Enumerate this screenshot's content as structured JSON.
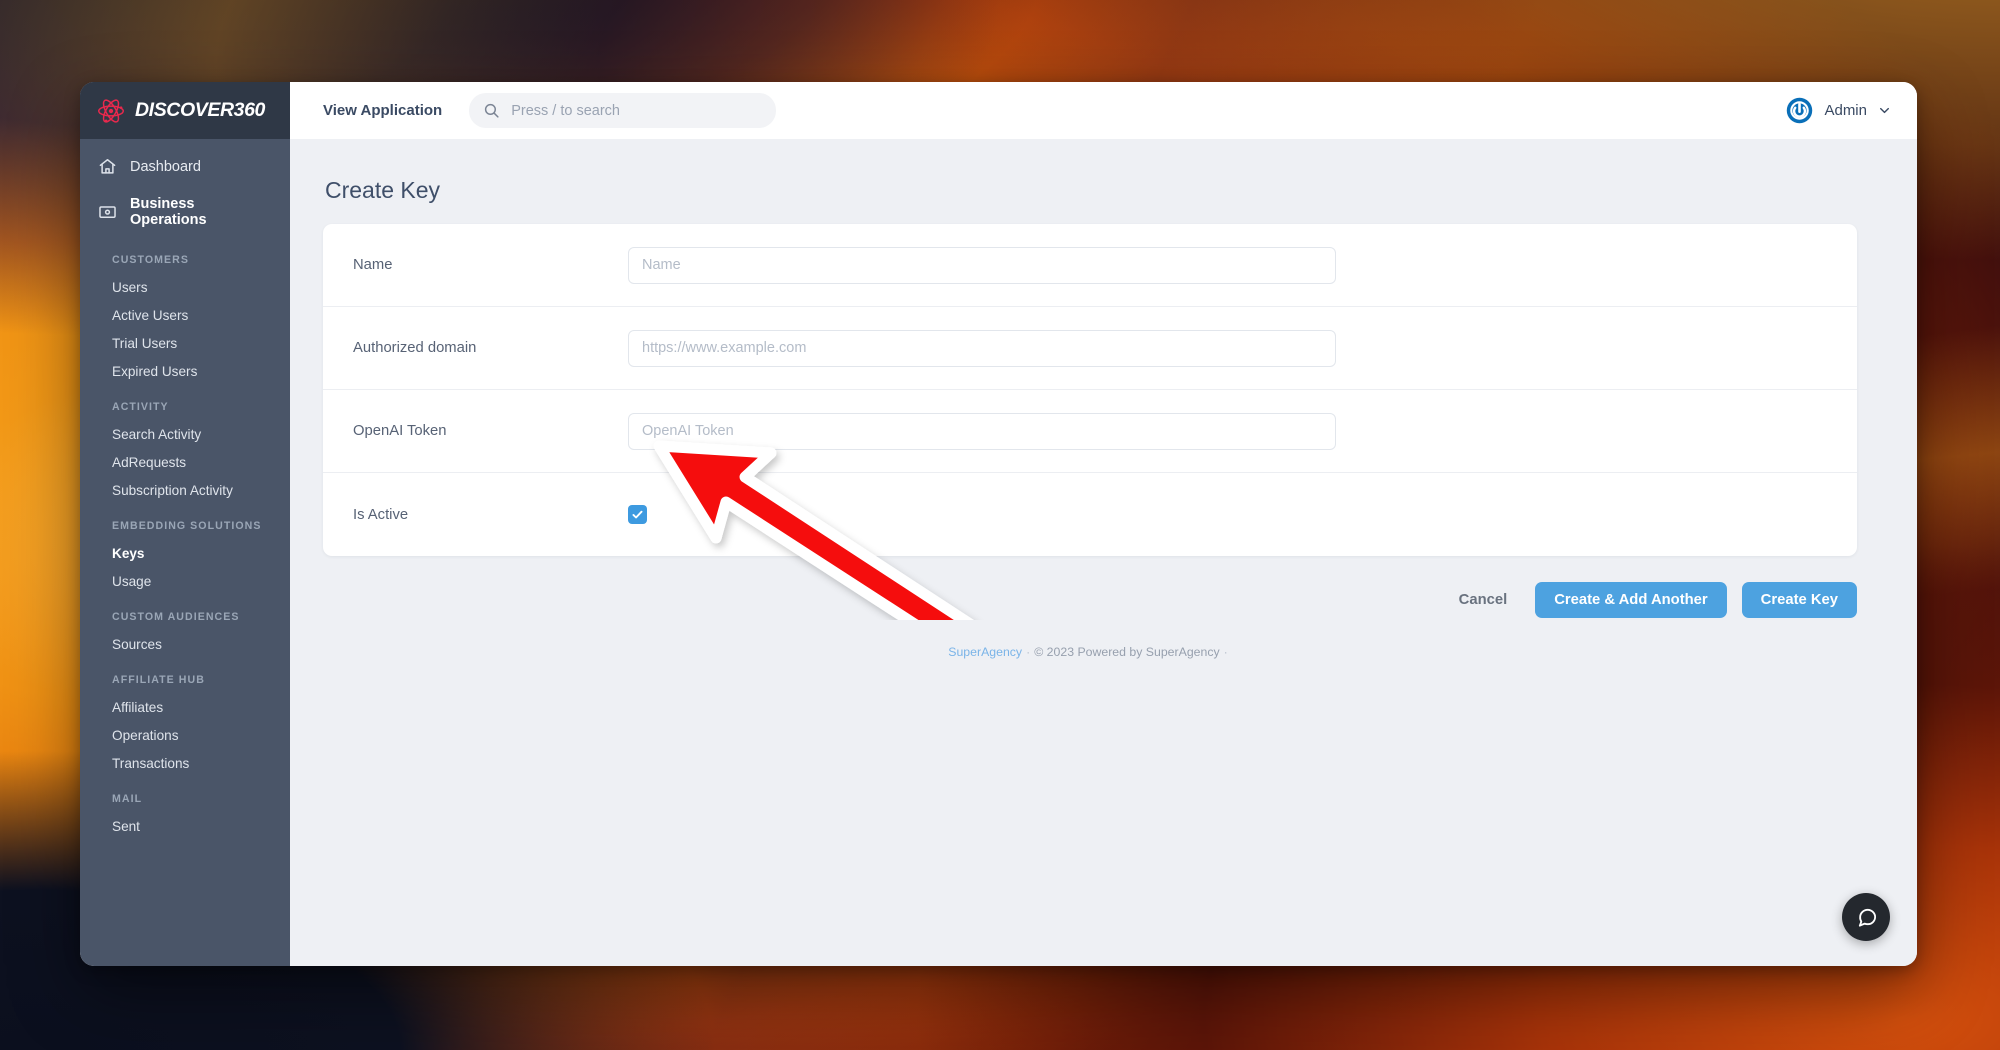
{
  "brand": {
    "name": "DISCOVER360",
    "logo_icon": "atom-icon",
    "logo_color": "#e8294d"
  },
  "sidebar": {
    "top_items": [
      {
        "label": "Dashboard",
        "icon": "home-icon",
        "bold": false
      },
      {
        "label": "Business Operations",
        "icon": "presentation-icon",
        "bold": true
      }
    ],
    "groups": [
      {
        "title": "CUSTOMERS",
        "items": [
          {
            "label": "Users",
            "active": false
          },
          {
            "label": "Active Users",
            "active": false
          },
          {
            "label": "Trial Users",
            "active": false
          },
          {
            "label": "Expired Users",
            "active": false
          }
        ]
      },
      {
        "title": "ACTIVITY",
        "items": [
          {
            "label": "Search Activity",
            "active": false
          },
          {
            "label": "AdRequests",
            "active": false
          },
          {
            "label": "Subscription Activity",
            "active": false
          }
        ]
      },
      {
        "title": "EMBEDDING SOLUTIONS",
        "items": [
          {
            "label": "Keys",
            "active": true
          },
          {
            "label": "Usage",
            "active": false
          }
        ]
      },
      {
        "title": "CUSTOM AUDIENCES",
        "items": [
          {
            "label": "Sources",
            "active": false
          }
        ]
      },
      {
        "title": "AFFILIATE HUB",
        "items": [
          {
            "label": "Affiliates",
            "active": false
          },
          {
            "label": "Operations",
            "active": false
          },
          {
            "label": "Transactions",
            "active": false
          }
        ]
      },
      {
        "title": "MAIL",
        "items": [
          {
            "label": "Sent",
            "active": false
          }
        ]
      }
    ]
  },
  "topbar": {
    "view_application_label": "View Application",
    "search": {
      "icon": "search-icon",
      "placeholder": "Press / to search",
      "value": ""
    },
    "user": {
      "label": "Admin",
      "avatar_icon": "power-circle-avatar-icon",
      "avatar_color": "#0a6fb8",
      "chevron_icon": "chevron-down-icon"
    }
  },
  "main": {
    "page_title": "Create Key",
    "form": {
      "rows": [
        {
          "label": "Name",
          "type": "text",
          "placeholder": "Name",
          "value": ""
        },
        {
          "label": "Authorized domain",
          "type": "text",
          "placeholder": "https://www.example.com",
          "value": ""
        },
        {
          "label": "OpenAI Token",
          "type": "text",
          "placeholder": "OpenAI Token",
          "value": ""
        },
        {
          "label": "Is Active",
          "type": "checkbox",
          "checked": true
        }
      ]
    },
    "actions": {
      "cancel_label": "Cancel",
      "create_add_another_label": "Create & Add Another",
      "create_key_label": "Create Key",
      "primary_color": "#4da2e0"
    },
    "footer": {
      "link_label": "SuperAgency",
      "separator": "·",
      "copyright": "© 2023 Powered by SuperAgency",
      "trailing_separator": "·"
    },
    "chat_fab": {
      "icon": "chat-bubble-icon",
      "background": "#24282e"
    }
  },
  "annotation": {
    "type": "arrow",
    "direction": "up-left",
    "fill": "#f50b0b",
    "stroke": "#ffffff",
    "points_at": "OpenAI Token"
  }
}
